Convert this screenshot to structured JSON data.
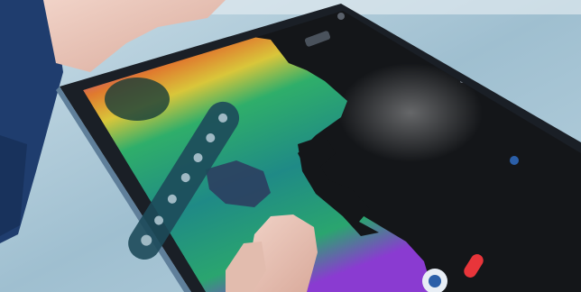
{
  "scene": {
    "description_visible_text": "",
    "tablet_status_text": "",
    "colors": {
      "background": "#a9c6d6",
      "tablet_bezel": "#1a1f26",
      "screen_dark": "#141619",
      "scan_teal": "#1f8a86",
      "scan_green": "#2fae6a",
      "scan_yellow": "#d9c63a",
      "scan_orange": "#e07a2e",
      "scan_magenta": "#b43bb9",
      "scan_purple": "#6a3bd1",
      "record_red": "#e8353a",
      "toolbar_bg": "#1d4a5a"
    },
    "toolbar_icons": [
      "layers-icon",
      "touch-icon",
      "eye-icon",
      "brush-icon",
      "scissors-icon",
      "thermometer-icon",
      "person-icon"
    ]
  }
}
